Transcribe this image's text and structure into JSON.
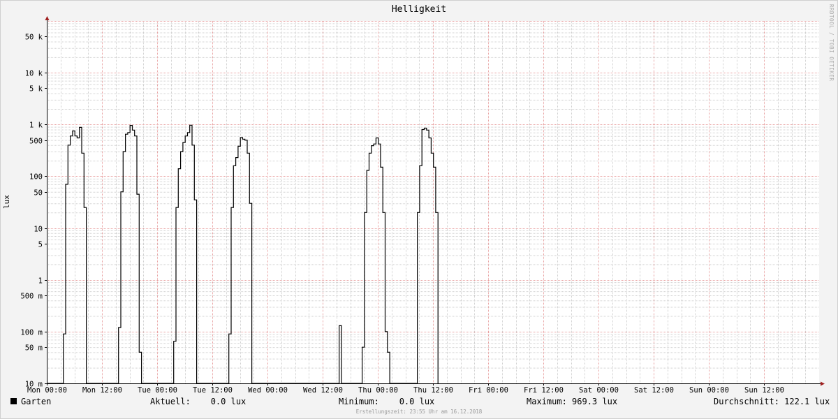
{
  "chart_data": {
    "type": "line",
    "title": "Helligkeit",
    "ylabel": "lux",
    "yscale": "log",
    "ylim": [
      0.01,
      100000
    ],
    "watermark": "RRDTOOL / TOBI OETIKER",
    "y_ticks": [
      {
        "value": 50000,
        "label": "50 k"
      },
      {
        "value": 10000,
        "label": "10 k"
      },
      {
        "value": 5000,
        "label": "5 k"
      },
      {
        "value": 1000,
        "label": "1 k"
      },
      {
        "value": 500,
        "label": "500"
      },
      {
        "value": 100,
        "label": "100"
      },
      {
        "value": 50,
        "label": "50"
      },
      {
        "value": 10,
        "label": "10"
      },
      {
        "value": 5,
        "label": "5"
      },
      {
        "value": 1,
        "label": "1"
      },
      {
        "value": 0.5,
        "label": "500 m"
      },
      {
        "value": 0.1,
        "label": "100 m"
      },
      {
        "value": 0.05,
        "label": "50 m"
      },
      {
        "value": 0.01,
        "label": "10 m"
      }
    ],
    "x_ticks": [
      {
        "hour": 0,
        "label": "Mon 00:00"
      },
      {
        "hour": 12,
        "label": "Mon 12:00"
      },
      {
        "hour": 24,
        "label": "Tue 00:00"
      },
      {
        "hour": 36,
        "label": "Tue 12:00"
      },
      {
        "hour": 48,
        "label": "Wed 00:00"
      },
      {
        "hour": 60,
        "label": "Wed 12:00"
      },
      {
        "hour": 72,
        "label": "Thu 00:00"
      },
      {
        "hour": 84,
        "label": "Thu 12:00"
      },
      {
        "hour": 96,
        "label": "Fri 00:00"
      },
      {
        "hour": 108,
        "label": "Fri 12:00"
      },
      {
        "hour": 120,
        "label": "Sat 00:00"
      },
      {
        "hour": 132,
        "label": "Sat 12:00"
      },
      {
        "hour": 144,
        "label": "Sun 00:00"
      },
      {
        "hour": 156,
        "label": "Sun 12:00"
      }
    ],
    "xlim": [
      0,
      168
    ],
    "series": [
      {
        "name": "Garten",
        "color": "#000000",
        "points": [
          [
            0,
            0.01
          ],
          [
            3.6,
            0.01
          ],
          [
            3.6,
            0.09
          ],
          [
            4.1,
            0.09
          ],
          [
            4.1,
            70
          ],
          [
            4.6,
            70
          ],
          [
            4.6,
            400
          ],
          [
            5.1,
            400
          ],
          [
            5.1,
            600
          ],
          [
            5.6,
            600
          ],
          [
            5.6,
            750
          ],
          [
            6.1,
            750
          ],
          [
            6.1,
            600
          ],
          [
            6.6,
            600
          ],
          [
            6.6,
            550
          ],
          [
            7.1,
            550
          ],
          [
            7.1,
            880
          ],
          [
            7.6,
            880
          ],
          [
            7.6,
            280
          ],
          [
            8.1,
            280
          ],
          [
            8.1,
            25
          ],
          [
            8.6,
            25
          ],
          [
            8.6,
            0.01
          ],
          [
            15.6,
            0.01
          ],
          [
            15.6,
            0.12
          ],
          [
            16.1,
            0.12
          ],
          [
            16.1,
            50
          ],
          [
            16.6,
            50
          ],
          [
            16.6,
            300
          ],
          [
            17.1,
            300
          ],
          [
            17.1,
            650
          ],
          [
            17.6,
            650
          ],
          [
            17.6,
            700
          ],
          [
            18.1,
            700
          ],
          [
            18.1,
            960
          ],
          [
            18.6,
            960
          ],
          [
            18.6,
            780
          ],
          [
            19.1,
            780
          ],
          [
            19.1,
            600
          ],
          [
            19.6,
            600
          ],
          [
            19.6,
            45
          ],
          [
            20.1,
            45
          ],
          [
            20.1,
            0.04
          ],
          [
            20.6,
            0.04
          ],
          [
            20.6,
            0.01
          ],
          [
            27.6,
            0.01
          ],
          [
            27.6,
            0.065
          ],
          [
            28.1,
            0.065
          ],
          [
            28.1,
            25
          ],
          [
            28.6,
            25
          ],
          [
            28.6,
            140
          ],
          [
            29.1,
            140
          ],
          [
            29.1,
            300
          ],
          [
            29.6,
            300
          ],
          [
            29.6,
            450
          ],
          [
            30.1,
            450
          ],
          [
            30.1,
            600
          ],
          [
            30.6,
            600
          ],
          [
            30.6,
            700
          ],
          [
            31.1,
            700
          ],
          [
            31.1,
            969.3
          ],
          [
            31.6,
            969.3
          ],
          [
            31.6,
            400
          ],
          [
            32.1,
            400
          ],
          [
            32.1,
            35
          ],
          [
            32.6,
            35
          ],
          [
            32.6,
            0.01
          ],
          [
            39.6,
            0.01
          ],
          [
            39.6,
            0.09
          ],
          [
            40.1,
            0.09
          ],
          [
            40.1,
            25
          ],
          [
            40.6,
            25
          ],
          [
            40.6,
            160
          ],
          [
            41.1,
            160
          ],
          [
            41.1,
            230
          ],
          [
            41.6,
            230
          ],
          [
            41.6,
            380
          ],
          [
            42.1,
            380
          ],
          [
            42.1,
            560
          ],
          [
            42.6,
            560
          ],
          [
            42.6,
            520
          ],
          [
            43.1,
            520
          ],
          [
            43.1,
            500
          ],
          [
            43.6,
            500
          ],
          [
            43.6,
            280
          ],
          [
            44.1,
            280
          ],
          [
            44.1,
            30
          ],
          [
            44.6,
            30
          ],
          [
            44.6,
            0.01
          ],
          [
            63.6,
            0.01
          ],
          [
            63.6,
            0.13
          ],
          [
            64.1,
            0.13
          ],
          [
            64.1,
            0.01
          ],
          [
            68.6,
            0.01
          ],
          [
            68.6,
            0.05
          ],
          [
            69.1,
            0.05
          ],
          [
            69.1,
            20
          ],
          [
            69.6,
            20
          ],
          [
            69.6,
            130
          ],
          [
            70.1,
            130
          ],
          [
            70.1,
            280
          ],
          [
            70.6,
            280
          ],
          [
            70.6,
            390
          ],
          [
            71.1,
            390
          ],
          [
            71.1,
            420
          ],
          [
            71.6,
            420
          ],
          [
            71.6,
            550
          ],
          [
            72.1,
            550
          ],
          [
            72.1,
            420
          ],
          [
            72.6,
            420
          ],
          [
            72.6,
            150
          ],
          [
            73.1,
            150
          ],
          [
            73.1,
            20
          ],
          [
            73.6,
            20
          ],
          [
            73.6,
            0.1
          ],
          [
            74.1,
            0.1
          ],
          [
            74.1,
            0.04
          ],
          [
            74.6,
            0.04
          ],
          [
            74.6,
            0.01
          ],
          [
            80.6,
            0.01
          ],
          [
            80.6,
            20
          ],
          [
            81.1,
            20
          ],
          [
            81.1,
            160
          ],
          [
            81.6,
            160
          ],
          [
            81.6,
            800
          ],
          [
            82.1,
            800
          ],
          [
            82.1,
            850
          ],
          [
            82.6,
            850
          ],
          [
            82.6,
            780
          ],
          [
            83.1,
            780
          ],
          [
            83.1,
            550
          ],
          [
            83.6,
            550
          ],
          [
            83.6,
            280
          ],
          [
            84.1,
            280
          ],
          [
            84.1,
            150
          ],
          [
            84.6,
            150
          ],
          [
            84.6,
            20
          ],
          [
            85.1,
            20
          ],
          [
            85.1,
            0.01
          ]
        ]
      }
    ]
  },
  "legend": {
    "series_label": "Garten",
    "current": "Aktuell:    0.0 lux",
    "minimum": "Minimum:    0.0 lux",
    "maximum": "Maximum: 969.3 lux",
    "average": "Durchschnitt: 122.1 lux"
  },
  "footer": "Erstellungszeit: 23:55 Uhr am 16.12.2018"
}
